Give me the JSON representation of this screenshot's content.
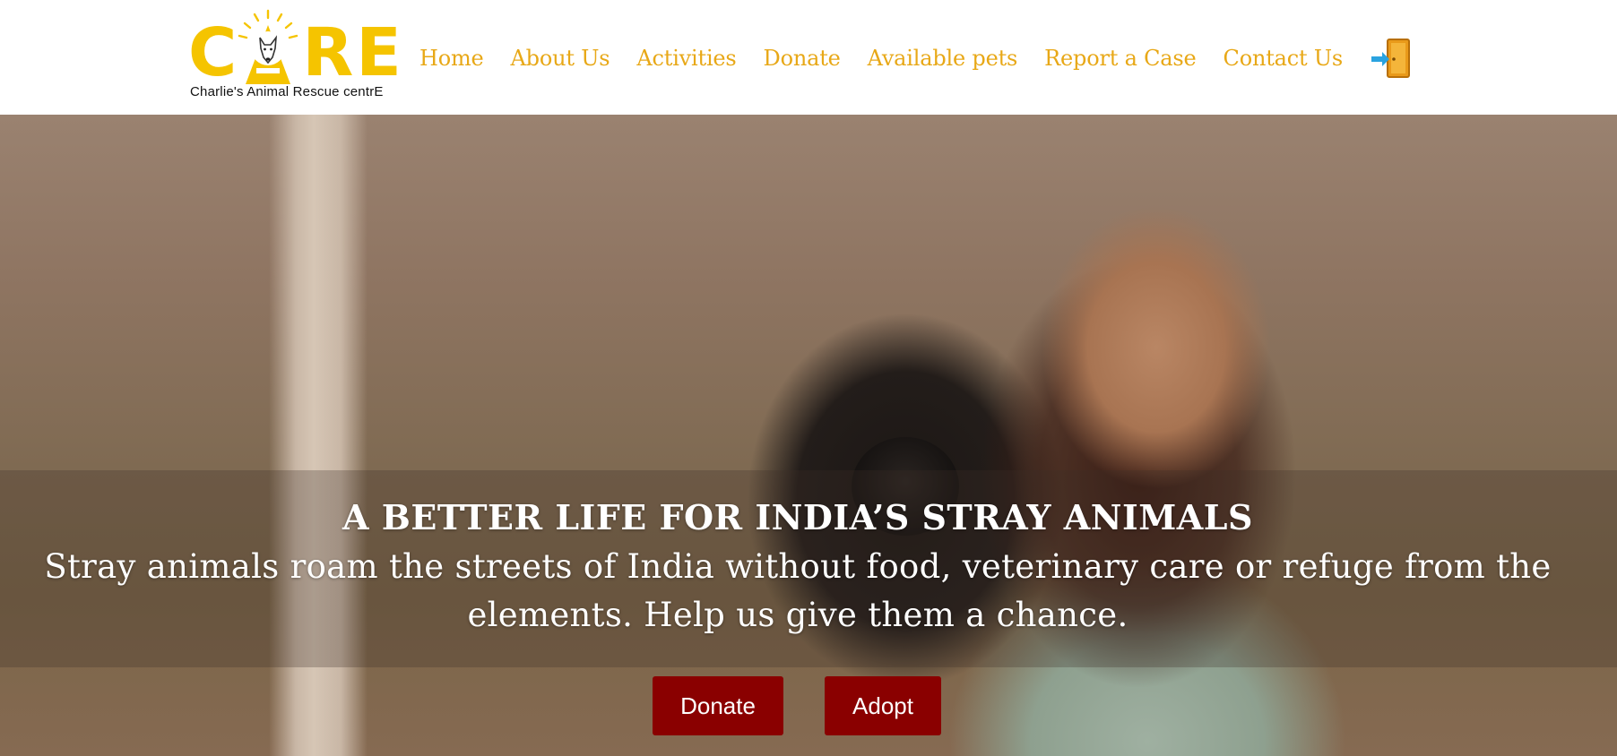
{
  "brand": {
    "logo_letters": [
      "C",
      "A",
      "R",
      "E"
    ],
    "tagline": "Charlie's Animal Rescue centrE",
    "logo_color": "#f5c400"
  },
  "nav": {
    "items": [
      {
        "label": "Home"
      },
      {
        "label": "About Us"
      },
      {
        "label": "Activities"
      },
      {
        "label": "Donate"
      },
      {
        "label": "Available pets"
      },
      {
        "label": "Report a Case"
      },
      {
        "label": "Contact Us"
      }
    ],
    "link_color": "#e8a817",
    "login_icon": "login-door-icon"
  },
  "hero": {
    "title": "A BETTER LIFE FOR INDIA’S STRAY ANIMALS",
    "text": "Stray animals roam the streets of India without food, veterinary care or refuge from the elements. Help us give them a chance.",
    "buttons": {
      "donate": "Donate",
      "adopt": "Adopt"
    },
    "button_color": "#8a0000"
  }
}
